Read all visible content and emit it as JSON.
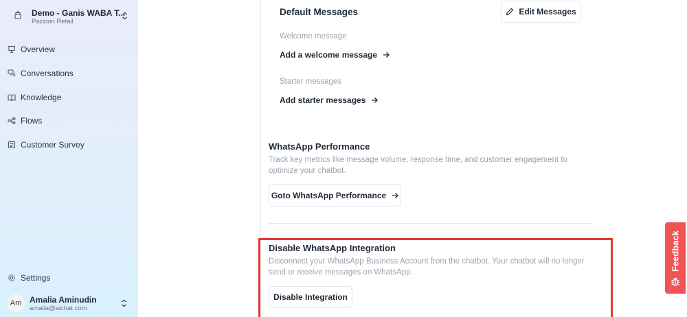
{
  "workspace": {
    "name": "Demo - Ganis WABA T...",
    "subtitle": "Pazzion Retail"
  },
  "sidebar": {
    "items": [
      {
        "label": "Overview",
        "icon": "presentation-icon"
      },
      {
        "label": "Conversations",
        "icon": "chat-bubbles-icon"
      },
      {
        "label": "Knowledge",
        "icon": "book-open-icon"
      },
      {
        "label": "Flows",
        "icon": "flow-nodes-icon"
      },
      {
        "label": "Customer Survey",
        "icon": "survey-icon"
      }
    ],
    "settings_label": "Settings"
  },
  "user": {
    "initials": "Am",
    "name": "Amalia Aminudin",
    "email": "amalia@aichat.com"
  },
  "default_messages": {
    "title": "Default Messages",
    "edit_button": "Edit Messages",
    "welcome_label": "Welcome message",
    "welcome_link": "Add a welcome message",
    "starter_label": "Starter messages",
    "starter_link": "Add starter messages"
  },
  "performance": {
    "title": "WhatsApp Performance",
    "description": "Track key metrics like message volume, response time, and customer engagement to optimize your chatbot.",
    "button": "Goto WhatsApp Performance"
  },
  "disable": {
    "title": "Disable WhatsApp Integration",
    "description": "Disconnect your WhatsApp Business Account from the chatbot. Your chatbot will no longer send or receive messages on WhatsApp.",
    "button": "Disable Integration"
  },
  "feedback": {
    "label": "Feedback"
  },
  "colors": {
    "highlight": "#e53935",
    "feedback_bg": "#f05454"
  }
}
